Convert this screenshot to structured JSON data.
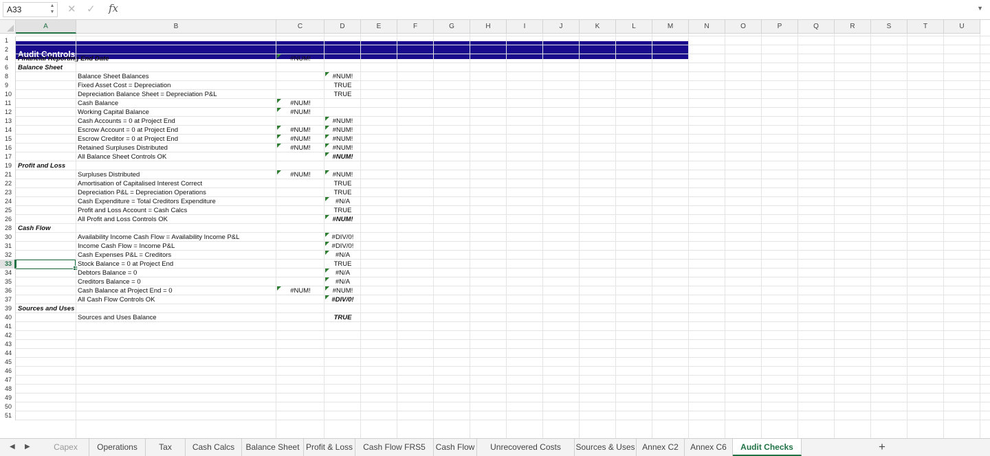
{
  "formula_bar": {
    "cell_ref": "A33",
    "cancel_icon": "x-icon",
    "confirm_icon": "check-icon",
    "fx_label": "fx",
    "formula_value": ""
  },
  "columns": [
    "A",
    "B",
    "C",
    "D",
    "E",
    "F",
    "G",
    "H",
    "I",
    "J",
    "K",
    "L",
    "M",
    "N",
    "O",
    "P",
    "Q",
    "R",
    "S",
    "T",
    "U"
  ],
  "active_column": "A",
  "active_row": "33",
  "rows": [
    "1",
    "2",
    "4",
    "6",
    "8",
    "9",
    "10",
    "11",
    "12",
    "13",
    "14",
    "15",
    "16",
    "17",
    "19",
    "21",
    "22",
    "23",
    "24",
    "25",
    "26",
    "28",
    "30",
    "31",
    "32",
    "33",
    "34",
    "35",
    "36",
    "37",
    "39",
    "40",
    "41",
    "42",
    "43",
    "44",
    "45",
    "46",
    "47",
    "48",
    "49",
    "50",
    "51"
  ],
  "banner_title": "Audit Controls",
  "sections": {
    "reporting_date": "Financial Reporting End Date",
    "balance_sheet": "Balance Sheet",
    "profit_loss": "Profit and Loss",
    "cash_flow": "Cash Flow",
    "sources_uses": "Sources and Uses"
  },
  "lines": [
    {
      "row": "4",
      "label": "",
      "c": "#NUM!",
      "d": "",
      "c_tri": true,
      "d_tri": false
    },
    {
      "row": "8",
      "label": "Balance Sheet Balances",
      "c": "",
      "d": "#NUM!",
      "c_tri": false,
      "d_tri": true
    },
    {
      "row": "9",
      "label": "Fixed Asset Cost = Depreciation",
      "c": "",
      "d": "TRUE",
      "c_tri": false,
      "d_tri": false
    },
    {
      "row": "10",
      "label": "Depreciation Balance Sheet = Depreciation P&L",
      "c": "",
      "d": "TRUE",
      "c_tri": false,
      "d_tri": false
    },
    {
      "row": "11",
      "label": "Cash Balance",
      "c": "#NUM!",
      "d": "",
      "c_tri": true,
      "d_tri": false
    },
    {
      "row": "12",
      "label": "Working Capital Balance",
      "c": "#NUM!",
      "d": "",
      "c_tri": true,
      "d_tri": false
    },
    {
      "row": "13",
      "label": "Cash Accounts = 0 at Project End",
      "c": "",
      "d": "#NUM!",
      "c_tri": false,
      "d_tri": true
    },
    {
      "row": "14",
      "label": "Escrow Account = 0 at Project End",
      "c": "#NUM!",
      "d": "#NUM!",
      "c_tri": true,
      "d_tri": true
    },
    {
      "row": "15",
      "label": "Escrow Creditor = 0 at Project End",
      "c": "#NUM!",
      "d": "#NUM!",
      "c_tri": true,
      "d_tri": true
    },
    {
      "row": "16",
      "label": "Retained Surpluses Distributed",
      "c": "#NUM!",
      "d": "#NUM!",
      "c_tri": true,
      "d_tri": true
    },
    {
      "row": "17",
      "label": "All Balance Sheet Controls OK",
      "c": "",
      "d": "#NUM!",
      "c_tri": false,
      "d_tri": true,
      "d_bold": true
    },
    {
      "row": "21",
      "label": "Surpluses Distributed",
      "c": "#NUM!",
      "d": "#NUM!",
      "c_tri": true,
      "d_tri": true
    },
    {
      "row": "22",
      "label": "Amortisation of Capitalised Interest Correct",
      "c": "",
      "d": "TRUE",
      "c_tri": false,
      "d_tri": false
    },
    {
      "row": "23",
      "label": "Depreciation P&L = Depreciation Operations",
      "c": "",
      "d": "TRUE",
      "c_tri": false,
      "d_tri": false
    },
    {
      "row": "24",
      "label": "Cash Expenditure = Total Creditors Expenditure",
      "c": "",
      "d": "#N/A",
      "c_tri": false,
      "d_tri": true
    },
    {
      "row": "25",
      "label": "Profit and Loss Account = Cash Calcs",
      "c": "",
      "d": "TRUE",
      "c_tri": false,
      "d_tri": false
    },
    {
      "row": "26",
      "label": "All Profit and Loss Controls OK",
      "c": "",
      "d": "#NUM!",
      "c_tri": false,
      "d_tri": true,
      "d_bold": true
    },
    {
      "row": "30",
      "label": "Availability Income Cash Flow = Availability Income P&L",
      "c": "",
      "d": "#DIV/0!",
      "c_tri": false,
      "d_tri": true
    },
    {
      "row": "31",
      "label": "Income Cash Flow = Income P&L",
      "c": "",
      "d": "#DIV/0!",
      "c_tri": false,
      "d_tri": true
    },
    {
      "row": "32",
      "label": "Cash Expenses P&L = Creditors",
      "c": "",
      "d": "#N/A",
      "c_tri": false,
      "d_tri": true
    },
    {
      "row": "33",
      "label": "Stock Balance = 0 at Project End",
      "c": "",
      "d": "TRUE",
      "c_tri": false,
      "d_tri": false
    },
    {
      "row": "34",
      "label": "Debtors Balance = 0",
      "c": "",
      "d": "#N/A",
      "c_tri": false,
      "d_tri": true
    },
    {
      "row": "35",
      "label": "Creditors Balance = 0",
      "c": "",
      "d": "#N/A",
      "c_tri": false,
      "d_tri": true
    },
    {
      "row": "36",
      "label": "Cash Balance at Project End = 0",
      "c": "#NUM!",
      "d": "#NUM!",
      "c_tri": true,
      "d_tri": true
    },
    {
      "row": "37",
      "label": "All Cash Flow Controls OK",
      "c": "",
      "d": "#DIV/0!",
      "c_tri": false,
      "d_tri": true,
      "d_bold": true
    },
    {
      "row": "40",
      "label": "Sources and Uses Balance",
      "c": "",
      "d": "TRUE",
      "c_tri": false,
      "d_tri": false,
      "d_bold": true
    }
  ],
  "sheet_tabs": [
    "Capex",
    "Operations",
    "Tax",
    "Cash Calcs",
    "Balance Sheet",
    "Profit & Loss",
    "Cash Flow FRS5",
    "Cash Flow",
    "Unrecovered Costs",
    "Sources & Uses",
    "Annex C2",
    "Annex C6",
    "Audit Checks"
  ],
  "active_tab": "Audit Checks",
  "add_sheet_label": "+",
  "colors": {
    "banner": "#1a0a8c",
    "accent": "#217346",
    "error_triangle": "#2e7d32"
  }
}
